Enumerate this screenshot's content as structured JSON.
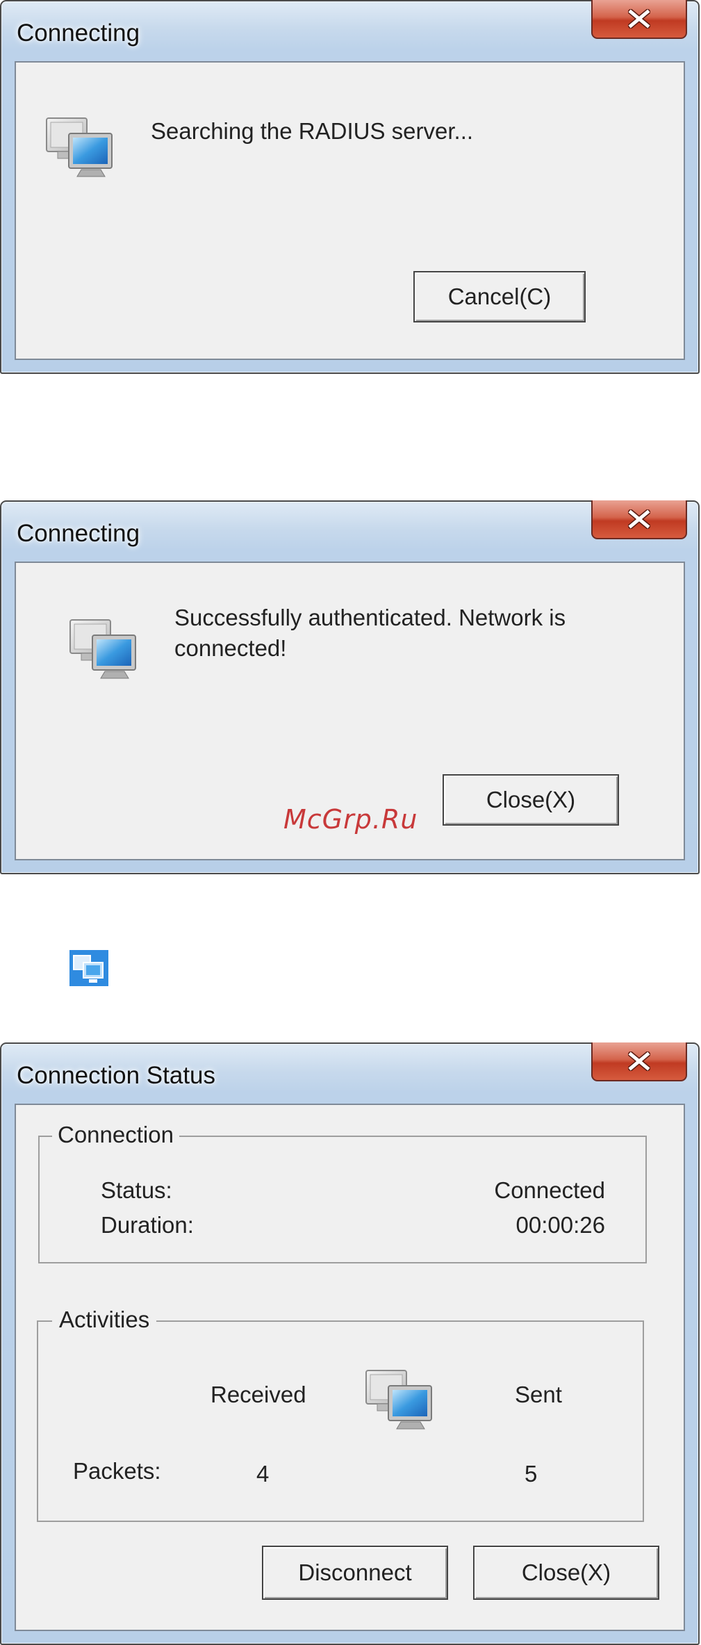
{
  "dialog1": {
    "title": "Connecting",
    "message": "Searching the RADIUS server...",
    "button": "Cancel(C)"
  },
  "dialog2": {
    "title": "Connecting",
    "message_line1": "Successfully authenticated. Network is",
    "message_line2": "connected!",
    "button": "Close(X)"
  },
  "watermark": "McGrp.Ru",
  "tray_icon": "network-computers-icon",
  "dialog3": {
    "title": "Connection Status",
    "connection_group": {
      "legend": "Connection",
      "status_label": "Status:",
      "status_value": "Connected",
      "duration_label": "Duration:",
      "duration_value": "00:00:26"
    },
    "activities_group": {
      "legend": "Activities",
      "received_label": "Received",
      "sent_label": "Sent",
      "packets_label": "Packets:",
      "packets_received": "4",
      "packets_sent": "5"
    },
    "disconnect_button": "Disconnect",
    "close_button": "Close(X)"
  },
  "colors": {
    "close_button_red": "#c03a22",
    "frame_blue": "#bcd2ea",
    "client_gray": "#f0f0f0",
    "watermark_red": "#c8393a"
  }
}
